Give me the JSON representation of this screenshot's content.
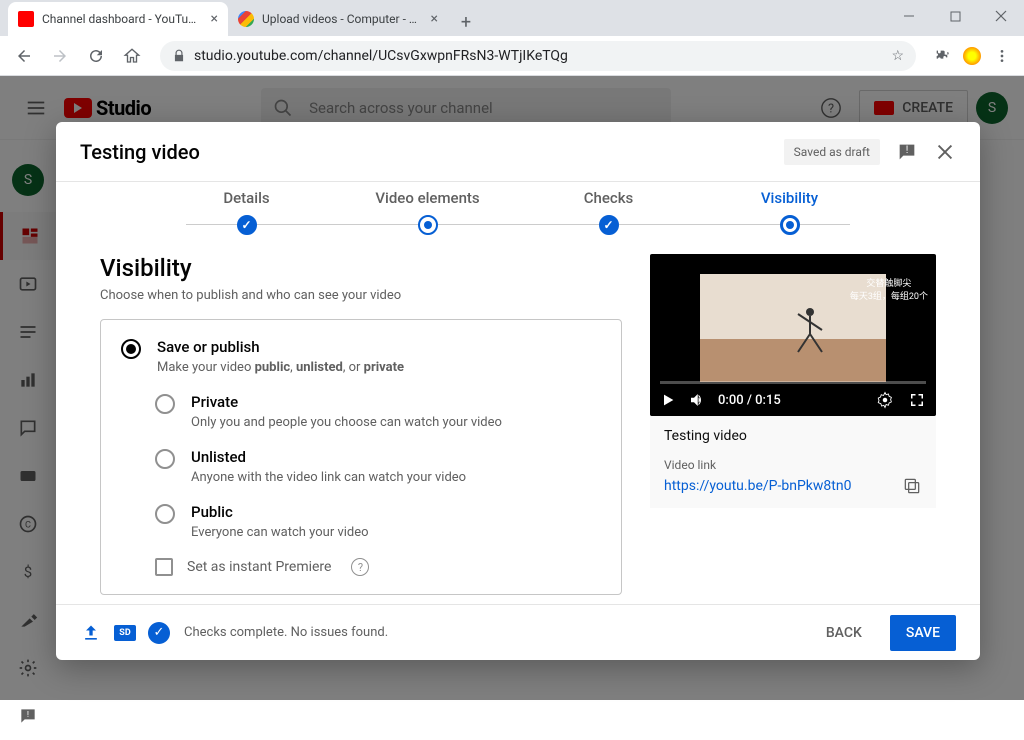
{
  "browser": {
    "tabs": [
      {
        "title": "Channel dashboard - YouTube St"
      },
      {
        "title": "Upload videos - Computer - You"
      }
    ],
    "url": "studio.youtube.com/channel/UCsvGxwpnFRsN3-WTjIKeTQg"
  },
  "header": {
    "brand": "Studio",
    "search_placeholder": "Search across your channel",
    "create_label": "CREATE",
    "avatar_initial": "S"
  },
  "dialog": {
    "title": "Testing video",
    "saved_badge": "Saved as draft",
    "stepper": {
      "details": "Details",
      "elements": "Video elements",
      "checks": "Checks",
      "visibility": "Visibility"
    },
    "visibility": {
      "heading": "Visibility",
      "sub": "Choose when to publish and who can see your video",
      "save_or_publish": {
        "label": "Save or publish",
        "desc_prefix": "Make your video ",
        "desc_bold1": "public",
        "desc_mid1": ", ",
        "desc_bold2": "unlisted",
        "desc_mid2": ", or ",
        "desc_bold3": "private"
      },
      "private": {
        "label": "Private",
        "desc": "Only you and people you choose can watch your video"
      },
      "unlisted": {
        "label": "Unlisted",
        "desc": "Anyone with the video link can watch your video"
      },
      "public": {
        "label": "Public",
        "desc": "Everyone can watch your video",
        "premiere": "Set as instant Premiere"
      }
    },
    "preview": {
      "time": "0:00 / 0:15",
      "overlay_text1": "交替触脚尖",
      "overlay_text2": "每天3组，每组20个",
      "title": "Testing video",
      "link_label": "Video link",
      "link": "https://youtu.be/P-bnPkw8tn0"
    },
    "footer": {
      "status": "Checks complete. No issues found.",
      "sd": "SD",
      "back": "BACK",
      "save": "SAVE"
    }
  }
}
